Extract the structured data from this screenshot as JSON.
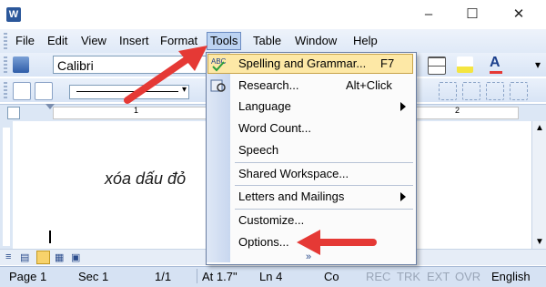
{
  "menu": {
    "file": "File",
    "edit": "Edit",
    "view": "View",
    "insert": "Insert",
    "format": "Format",
    "tools": "Tools",
    "table": "Table",
    "window": "Window",
    "help": "Help"
  },
  "toolbar": {
    "font_name": "Calibri"
  },
  "document": {
    "text": "xóa dấu đỏ"
  },
  "ruler": {
    "tick_1": "1",
    "tick_2": "2"
  },
  "tools_menu": {
    "spelling": {
      "label": "Spelling and Grammar...",
      "shortcut": "F7"
    },
    "research": {
      "label": "Research...",
      "shortcut": "Alt+Click"
    },
    "language": {
      "label": "Language"
    },
    "word_count": {
      "label": "Word Count..."
    },
    "speech": {
      "label": "Speech"
    },
    "shared_workspace": {
      "label": "Shared Workspace..."
    },
    "letters_mailings": {
      "label": "Letters and Mailings"
    },
    "customize": {
      "label": "Customize..."
    },
    "options": {
      "label": "Options..."
    }
  },
  "status": {
    "page": "Page 1",
    "sec": "Sec 1",
    "pages": "1/1",
    "at": "At 1.7\"",
    "ln": "Ln 4",
    "col": "Co",
    "rec": "REC",
    "trk": "TRK",
    "ext": "EXT",
    "ovr": "OVR",
    "language": "English"
  },
  "colors": {
    "accent_red": "#e53935",
    "menu_highlight": "#fde8a6",
    "toolbar_blue": "#dfe9f7"
  }
}
